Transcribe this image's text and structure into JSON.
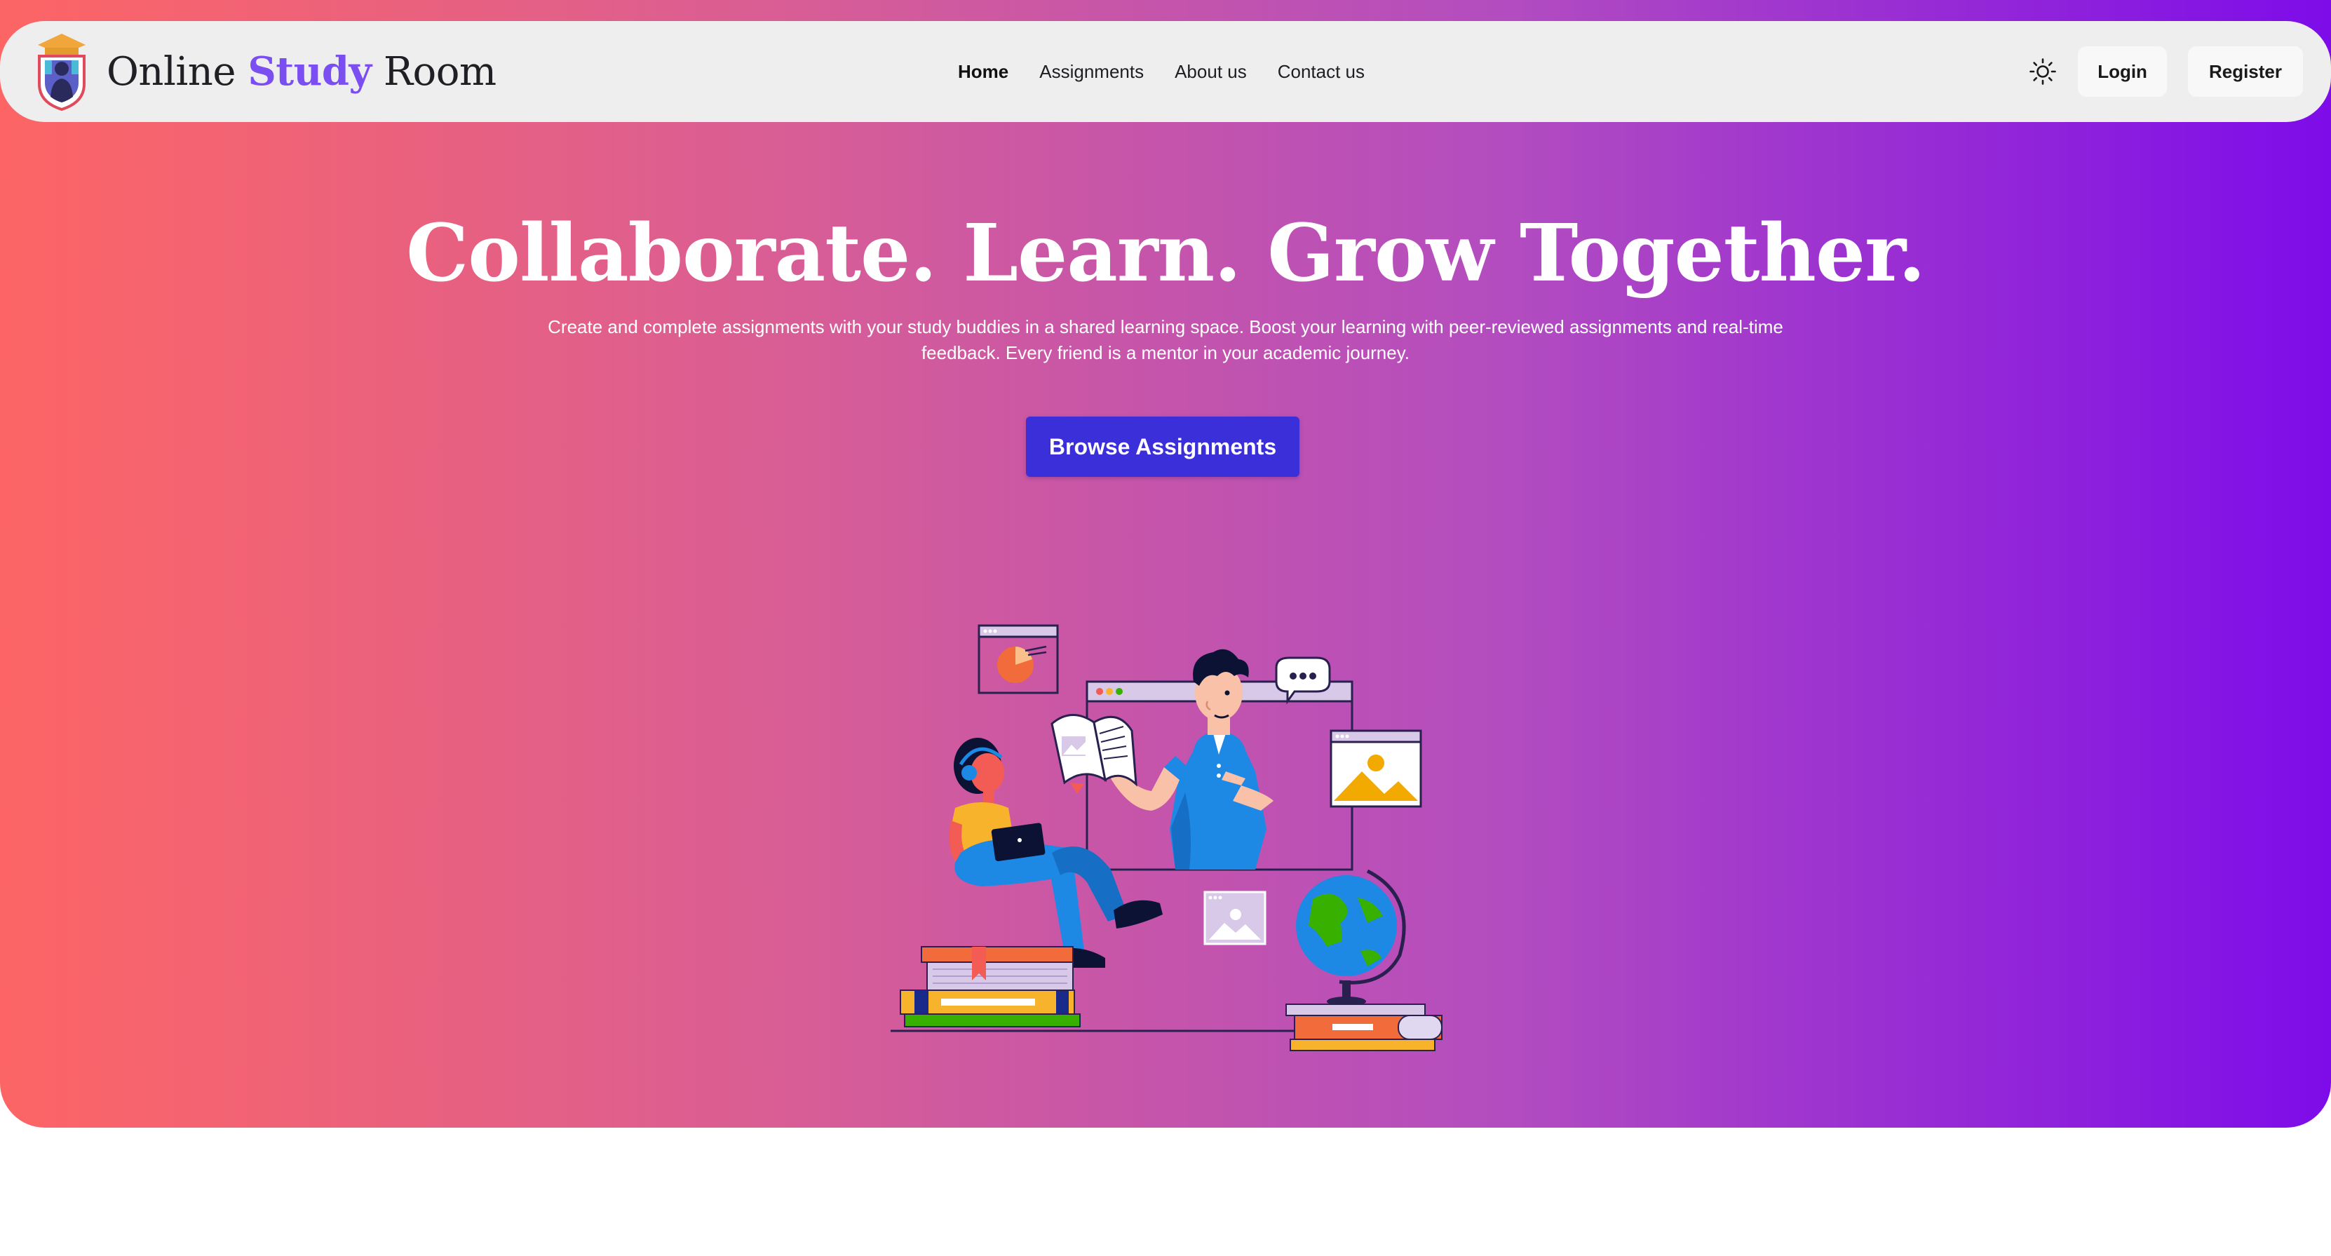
{
  "brand": {
    "name_part1": "Online",
    "name_accent": "Study",
    "name_part2": "Room",
    "logo_icon": "graduation-shield-icon"
  },
  "nav": {
    "links": [
      "Home",
      "Assignments",
      "About us",
      "Contact us"
    ],
    "active": "Home",
    "theme_toggle_icon": "sun-icon",
    "login_label": "Login",
    "register_label": "Register"
  },
  "hero": {
    "headline": "Collaborate. Learn. Grow Together.",
    "subtext": "Create and complete assignments with your study buddies in a shared learning space. Boost your learning with peer-reviewed assignments and real-time feedback. Every friend is a mentor in your academic journey.",
    "cta_label": "Browse Assignments",
    "illustration_icon": "students-studying-illustration"
  },
  "colors": {
    "gradient_start": "#fd6565",
    "gradient_end": "#7d0ce9",
    "navbar_bg": "#eeeeef",
    "brand_accent": "#7a4ef0",
    "cta_bg": "#3b2fd9"
  }
}
